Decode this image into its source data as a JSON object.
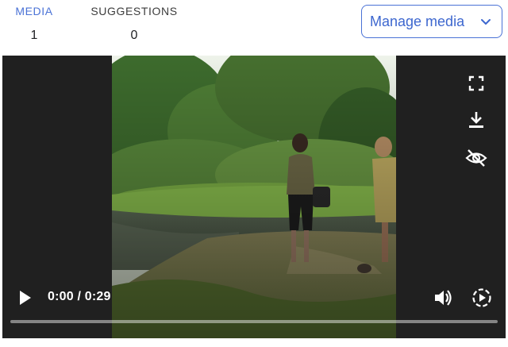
{
  "stats": {
    "media": {
      "label": "MEDIA",
      "value": "1"
    },
    "suggestions": {
      "label": "SUGGESTIONS",
      "value": "0"
    }
  },
  "manage_button": {
    "label": "Manage media",
    "icon": "chevron-down-icon"
  },
  "player": {
    "current_time": "0:00",
    "duration": "0:29",
    "time_text": "0:00 / 0:29",
    "progress": 0,
    "controls": [
      "play-icon",
      "volume-icon",
      "playback-speed-icon",
      "fullscreen-icon",
      "download-icon",
      "hide-icon"
    ]
  },
  "colors": {
    "accent": "#4a72d6",
    "player_bg": "#202020"
  }
}
